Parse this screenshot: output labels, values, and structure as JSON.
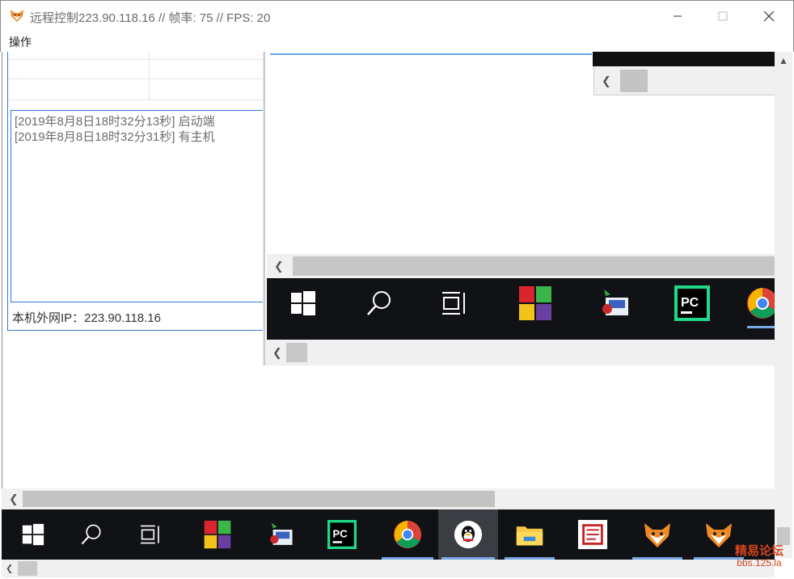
{
  "window": {
    "title": "远程控制223.90.118.16 //  帧率:  75 //  FPS:  20",
    "minimize_glyph": "—",
    "maximize_glyph": "☐",
    "close_glyph": "✕"
  },
  "menu": {
    "items": [
      {
        "label": "操作"
      }
    ]
  },
  "remote_log": {
    "lines": [
      "[2019年8月8日18时32分13秒]   启动端",
      "[2019年8月8日18时32分31秒]   有主机"
    ],
    "ip_label": "本机外网IP：223.90.118.16"
  },
  "taskbar_icons": [
    {
      "name": "windows-start-icon"
    },
    {
      "name": "search-icon"
    },
    {
      "name": "task-view-icon"
    },
    {
      "name": "winrar-icon"
    },
    {
      "name": "e-language-icon"
    },
    {
      "name": "pycharm-icon",
      "text": "PC"
    },
    {
      "name": "chrome-icon"
    },
    {
      "name": "qq-icon"
    },
    {
      "name": "file-explorer-icon"
    },
    {
      "name": "red-app-icon"
    },
    {
      "name": "fox-app-icon"
    },
    {
      "name": "fox-app-icon-2"
    }
  ],
  "watermark": {
    "line1": "精易论坛",
    "line2": "bbs.125.la"
  },
  "colors": {
    "accent_blue": "#2e7bd6",
    "taskbar": "#101216",
    "watermark": "#d4441c"
  }
}
